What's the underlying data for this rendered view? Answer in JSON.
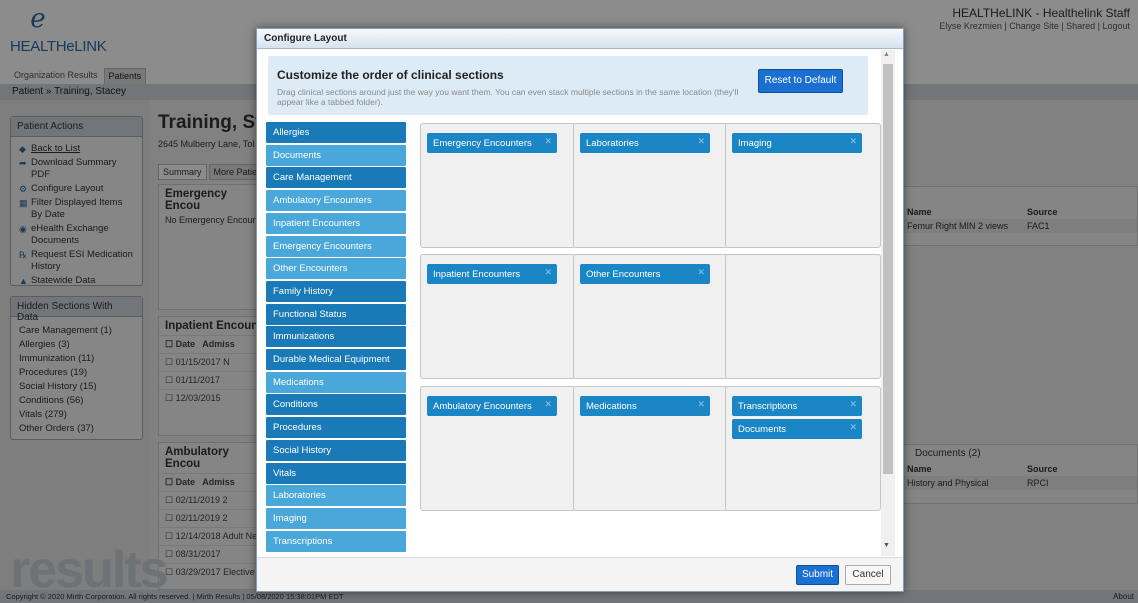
{
  "app": {
    "logo_text": "HEALTHeLINK",
    "title": "HEALTHeLINK - Healthelink Staff",
    "user_links": [
      "Elyse Krezmien",
      "Change Site",
      "Shared",
      "Logout"
    ]
  },
  "tabs": [
    "Organization Results",
    "Patients"
  ],
  "breadcrumb": "Patient » Training, Stacey",
  "patient_actions": {
    "title": "Patient Actions",
    "items": [
      {
        "label": "Back to List",
        "icon": "back-icon"
      },
      {
        "label": "Download Summary PDF",
        "icon": "download-icon"
      },
      {
        "label": "Configure Layout",
        "icon": "gear-icon"
      },
      {
        "label": "Filter Displayed Items By Date",
        "icon": "calendar-icon"
      },
      {
        "label": "eHealth Exchange Documents",
        "icon": "exchange-icon"
      },
      {
        "label": "Request ESI Medication History",
        "icon": "rx-icon"
      },
      {
        "label": "Statewide Data",
        "icon": "map-icon"
      }
    ]
  },
  "hidden_sections": {
    "title": "Hidden Sections With Data",
    "items": [
      "Care Management (1)",
      "Allergies (3)",
      "Immunization (11)",
      "Procedures (19)",
      "Social History (15)",
      "Conditions (56)",
      "Vitals (279)",
      "Other Orders (37)"
    ]
  },
  "patient": {
    "name": "Training, St",
    "address": "2645 Mulberry Lane, Tol",
    "tabs": [
      "Summary",
      "More Patient"
    ]
  },
  "bg_sections": {
    "emergency": {
      "title": "Emergency Encou",
      "empty": "No Emergency Encoun"
    },
    "inpatient": {
      "title": "Inpatient Encount",
      "headers": [
        "Date",
        "Admiss"
      ],
      "rows": [
        "01/15/2017  N",
        "01/11/2017",
        "12/03/2015"
      ]
    },
    "ambulatory": {
      "title": "Ambulatory Encou",
      "headers": [
        "Date",
        "Admiss"
      ],
      "rows": [
        "02/11/2019  2",
        "02/11/2019  2",
        "12/14/2018  Adult Ne",
        "08/31/2017",
        "03/29/2017  Elective"
      ]
    },
    "imaging": {
      "headers": [
        "Name",
        "Source"
      ],
      "row": [
        "Femur Right MIN 2 views",
        "FAC1"
      ]
    },
    "documents": {
      "title": "Documents (2)",
      "headers": [
        "Name",
        "Source"
      ],
      "row": [
        "History and Physical",
        "RPCI"
      ]
    }
  },
  "watermark": "results",
  "footer": "Copyright © 2020 Mirth Corporation. All rights reserved. | Mirth Results | 05/08/2020 15:38:01PM EDT",
  "footer_right": "About",
  "modal": {
    "title": "Configure Layout",
    "heading": "Customize the order of clinical sections",
    "description": "Drag clinical sections around just the way you want them. You can even stack multiple sections in the same location (they'll appear like a tabbed folder).",
    "reset_label": "Reset to Default",
    "section_list": [
      {
        "label": "Allergies",
        "shade": "dark"
      },
      {
        "label": "Documents",
        "shade": "light"
      },
      {
        "label": "Care Management",
        "shade": "dark"
      },
      {
        "label": "Ambulatory Encounters",
        "shade": "light"
      },
      {
        "label": "Inpatient Encounters",
        "shade": "light"
      },
      {
        "label": "Emergency Encounters",
        "shade": "light"
      },
      {
        "label": "Other Encounters",
        "shade": "light"
      },
      {
        "label": "Family History",
        "shade": "dark"
      },
      {
        "label": "Functional Status",
        "shade": "dark"
      },
      {
        "label": "Immunizations",
        "shade": "dark"
      },
      {
        "label": "Durable Medical Equipment",
        "shade": "dark"
      },
      {
        "label": "Medications",
        "shade": "light"
      },
      {
        "label": "Conditions",
        "shade": "dark"
      },
      {
        "label": "Procedures",
        "shade": "dark"
      },
      {
        "label": "Social History",
        "shade": "dark"
      },
      {
        "label": "Vitals",
        "shade": "dark"
      },
      {
        "label": "Laboratories",
        "shade": "light"
      },
      {
        "label": "Imaging",
        "shade": "light"
      },
      {
        "label": "Transcriptions",
        "shade": "light"
      }
    ],
    "grid": [
      [
        "Emergency Encounters"
      ],
      [
        "Laboratories"
      ],
      [
        "Imaging"
      ],
      [
        "Inpatient Encounters"
      ],
      [
        "Other Encounters"
      ],
      [],
      [
        "Ambulatory Encounters"
      ],
      [
        "Medications"
      ],
      [
        "Transcriptions",
        "Documents"
      ]
    ],
    "close_glyph": "✕",
    "submit_label": "Submit",
    "cancel_label": "Cancel"
  }
}
